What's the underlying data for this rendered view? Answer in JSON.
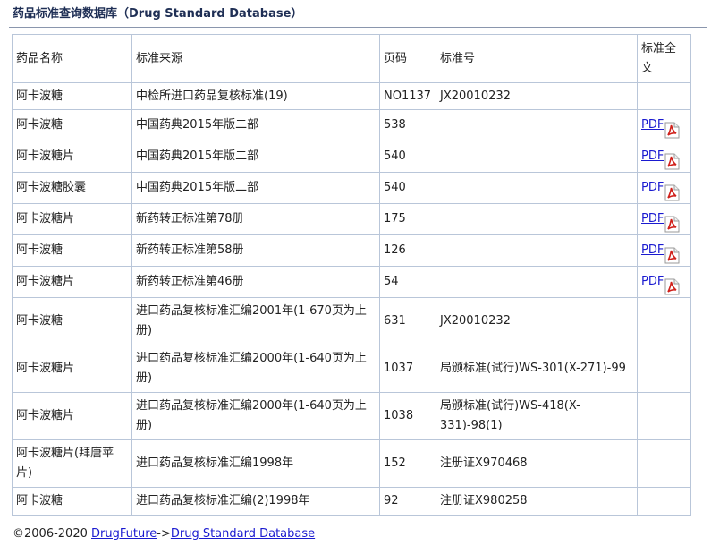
{
  "page_title": "药品标准查询数据库（Drug Standard Database）",
  "table": {
    "headers": {
      "name": "药品名称",
      "source": "标准来源",
      "page": "页码",
      "std_no": "标准号",
      "full_text": "标准全文"
    },
    "rows": [
      {
        "name": "阿卡波糖",
        "source": "中检所进口药品复核标准(19)",
        "page": "NO1137",
        "std_no": "JX20010232",
        "pdf": ""
      },
      {
        "name": "阿卡波糖",
        "source": "中国药典2015年版二部",
        "page": "538",
        "std_no": "",
        "pdf": "PDF"
      },
      {
        "name": "阿卡波糖片",
        "source": "中国药典2015年版二部",
        "page": "540",
        "std_no": "",
        "pdf": "PDF"
      },
      {
        "name": "阿卡波糖胶囊",
        "source": "中国药典2015年版二部",
        "page": "540",
        "std_no": "",
        "pdf": "PDF"
      },
      {
        "name": "阿卡波糖片",
        "source": "新药转正标准第78册",
        "page": "175",
        "std_no": "",
        "pdf": "PDF"
      },
      {
        "name": "阿卡波糖",
        "source": "新药转正标准第58册",
        "page": "126",
        "std_no": "",
        "pdf": "PDF"
      },
      {
        "name": "阿卡波糖片",
        "source": "新药转正标准第46册",
        "page": "54",
        "std_no": "",
        "pdf": "PDF"
      },
      {
        "name": "阿卡波糖",
        "source": "进口药品复核标准汇编2001年(1-670页为上册)",
        "page": "631",
        "std_no": "JX20010232",
        "pdf": ""
      },
      {
        "name": "阿卡波糖片",
        "source": "进口药品复核标准汇编2000年(1-640页为上册)",
        "page": "1037",
        "std_no": "局颁标准(试行)WS-301(X-271)-99",
        "pdf": ""
      },
      {
        "name": "阿卡波糖片",
        "source": "进口药品复核标准汇编2000年(1-640页为上册)",
        "page": "1038",
        "std_no": "局颁标准(试行)WS-418(X-331)-98(1)",
        "pdf": ""
      },
      {
        "name": "阿卡波糖片(拜唐苹片)",
        "source": "进口药品复核标准汇编1998年",
        "page": "152",
        "std_no": "注册证X970468",
        "pdf": ""
      },
      {
        "name": "阿卡波糖",
        "source": "进口药品复核标准汇编(2)1998年",
        "page": "92",
        "std_no": "注册证X980258",
        "pdf": ""
      }
    ]
  },
  "footer": {
    "copyright": "©2006-2020 ",
    "link1": "DrugFuture",
    "separator": "->",
    "link2": "Drug Standard Database"
  },
  "icons": {
    "pdf": "pdf-file-icon"
  },
  "colors": {
    "link": "#1a1ad0",
    "border": "#b9c6d9",
    "title": "#1f2f55",
    "pdf_red": "#d0201a"
  }
}
